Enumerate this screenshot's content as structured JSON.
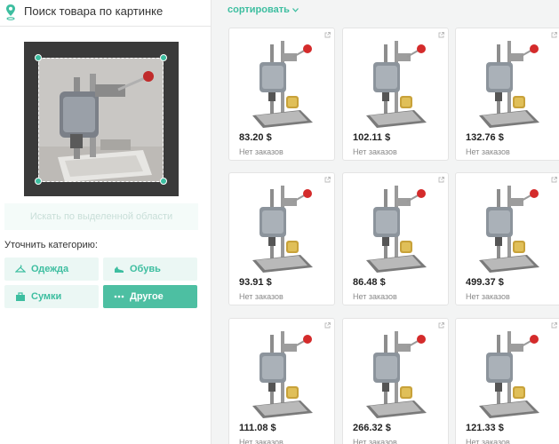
{
  "left": {
    "title": "Поиск товара по картинке",
    "search_button": "Искать по выделенной области",
    "refine_label": "Уточнить категорию:",
    "categories": [
      {
        "label": "Одежда",
        "icon": "hanger-icon",
        "active": false
      },
      {
        "label": "Обувь",
        "icon": "shoe-icon",
        "active": false
      },
      {
        "label": "Сумки",
        "icon": "bag-icon",
        "active": false
      },
      {
        "label": "Другое",
        "icon": "dots-icon",
        "active": true
      }
    ]
  },
  "right": {
    "sort_label": "сортировать",
    "products": [
      {
        "price": "83.20 $",
        "orders": "Нет заказов"
      },
      {
        "price": "102.11 $",
        "orders": "Нет заказов"
      },
      {
        "price": "132.76 $",
        "orders": "Нет заказов"
      },
      {
        "price": "93.91 $",
        "orders": "Нет заказов"
      },
      {
        "price": "86.48 $",
        "orders": "Нет заказов"
      },
      {
        "price": "499.37 $",
        "orders": "Нет заказов"
      },
      {
        "price": "111.08 $",
        "orders": "Нет заказов"
      },
      {
        "price": "266.32 $",
        "orders": "Нет заказов"
      },
      {
        "price": "121.33 $",
        "orders": "Нет заказов"
      }
    ]
  },
  "colors": {
    "accent": "#3dbea0",
    "accent_active": "#4dbfa2",
    "accent_light": "#ebf7f4"
  }
}
